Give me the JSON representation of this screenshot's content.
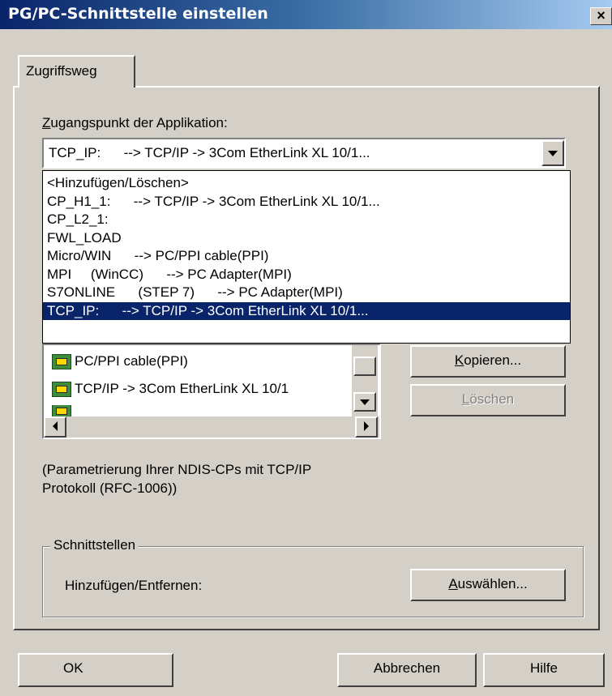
{
  "window": {
    "title": "PG/PC-Schnittstelle einstellen",
    "close_glyph": "×"
  },
  "tab": {
    "label": "Zugriffsweg"
  },
  "access_point": {
    "label_underlined": "Z",
    "label_rest": "ugangspunkt der Applikation:",
    "selected": "TCP_IP:      --> TCP/IP -> 3Com EtherLink XL 10/1..."
  },
  "dropdown": {
    "items": [
      "<Hinzufügen/Löschen>",
      "CP_H1_1:      --> TCP/IP -> 3Com EtherLink XL 10/1...",
      "CP_L2_1:",
      "FWL_LOAD",
      "Micro/WIN      --> PC/PPI cable(PPI)",
      "MPI     (WinCC)      --> PC Adapter(MPI)",
      "S7ONLINE      (STEP 7)      --> PC Adapter(MPI)",
      "TCP_IP:      --> TCP/IP -> 3Com EtherLink XL 10/1..."
    ],
    "selected_index": 7
  },
  "interface_list": {
    "items": [
      "PC/PPI cable(PPI)",
      "TCP/IP -> 3Com EtherLink XL 10/1"
    ],
    "icon": "network-card-icon"
  },
  "buttons": {
    "copy_underlined": "K",
    "copy_rest": "opieren...",
    "delete_underlined": "L",
    "delete_rest": "öschen",
    "select_underlined": "A",
    "select_rest": "uswählen...",
    "ok": "OK",
    "cancel": "Abbrechen",
    "help": "Hilfe"
  },
  "description": {
    "line1": "(Parametrierung Ihrer NDIS-CPs mit TCP/IP",
    "line2": "Protokoll (RFC-1006))"
  },
  "interfaces_group": {
    "legend": "Schnittstellen",
    "label": "Hinzufügen/Entfernen:"
  },
  "colors": {
    "face": "#d4d0c8",
    "title_start": "#0a246a",
    "title_end": "#a6caf0",
    "selection": "#0a246a"
  }
}
